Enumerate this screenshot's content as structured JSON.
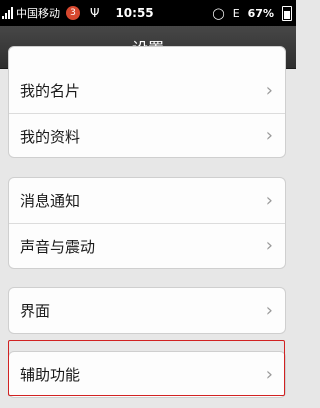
{
  "status_bar": {
    "carrier": "中国移动",
    "notification_count": "3",
    "usb": "Ψ",
    "time": "10:55",
    "battery": "67%",
    "data_type": "E"
  },
  "header": {
    "title": "设置"
  },
  "groups": [
    {
      "items": [
        {
          "label": "我的名片",
          "chevron": "›"
        },
        {
          "label": "我的资料",
          "chevron": "›"
        }
      ]
    },
    {
      "items": [
        {
          "label": "消息通知",
          "chevron": "›"
        },
        {
          "label": "声音与震动",
          "chevron": "›"
        }
      ]
    },
    {
      "items": [
        {
          "label": "界面",
          "chevron": "›"
        }
      ]
    },
    {
      "items": [
        {
          "label": "辅助功能",
          "chevron": "›"
        }
      ]
    }
  ],
  "colors": {
    "status_bar": "#000000",
    "title_bar": "#3a3a3a",
    "background": "#e7e7e7",
    "highlight": "#d12222",
    "badge": "#d7482f"
  }
}
